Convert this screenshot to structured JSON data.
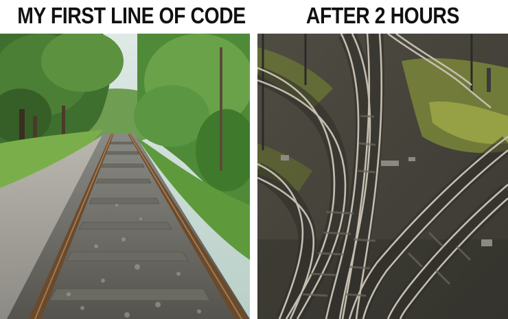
{
  "meme": {
    "left_caption": "MY FIRST LINE OF CODE",
    "right_caption": "AFTER 2 HOURS"
  }
}
